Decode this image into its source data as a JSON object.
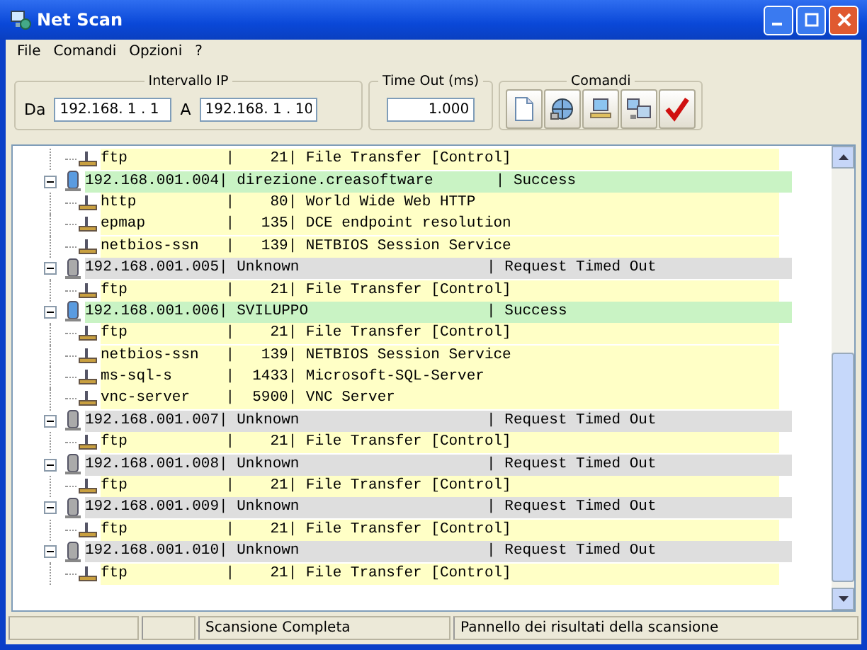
{
  "window": {
    "title": "Net Scan"
  },
  "menu": [
    {
      "label": "File"
    },
    {
      "label": "Comandi"
    },
    {
      "label": "Opzioni"
    },
    {
      "label": "?"
    }
  ],
  "ip_range": {
    "title": "Intervallo IP",
    "from_label": "Da",
    "from": "192.168. 1 . 1",
    "to_label": "A",
    "to": "192.168. 1 . 10"
  },
  "timeout": {
    "title": "Time Out (ms)",
    "value": "1.000"
  },
  "commands": {
    "title": "Comandi",
    "buttons": [
      {
        "kind": "new"
      },
      {
        "kind": "network"
      },
      {
        "kind": "computer"
      },
      {
        "kind": "computers"
      },
      {
        "kind": "check"
      }
    ]
  },
  "tree": [
    {
      "kind": "service",
      "text": "ftp           |    21| File Transfer [Control]"
    },
    {
      "kind": "host",
      "reachable": true,
      "expanded": true,
      "text": "192.168.001.004| direzione.creasoftware       | Success",
      "children": [
        {
          "kind": "service",
          "text": "http          |    80| World Wide Web HTTP"
        },
        {
          "kind": "service",
          "text": "epmap         |   135| DCE endpoint resolution"
        },
        {
          "kind": "service",
          "text": "netbios-ssn   |   139| NETBIOS Session Service"
        }
      ]
    },
    {
      "kind": "host",
      "reachable": false,
      "expanded": true,
      "text": "192.168.001.005| Unknown                     | Request Timed Out",
      "children": [
        {
          "kind": "service",
          "text": "ftp           |    21| File Transfer [Control]"
        }
      ]
    },
    {
      "kind": "host",
      "reachable": true,
      "expanded": true,
      "text": "192.168.001.006| SVILUPPO                    | Success",
      "children": [
        {
          "kind": "service",
          "text": "ftp           |    21| File Transfer [Control]"
        },
        {
          "kind": "service",
          "text": "netbios-ssn   |   139| NETBIOS Session Service"
        },
        {
          "kind": "service",
          "text": "ms-sql-s      |  1433| Microsoft-SQL-Server"
        },
        {
          "kind": "service",
          "text": "vnc-server    |  5900| VNC Server"
        }
      ]
    },
    {
      "kind": "host",
      "reachable": false,
      "expanded": true,
      "text": "192.168.001.007| Unknown                     | Request Timed Out",
      "children": [
        {
          "kind": "service",
          "text": "ftp           |    21| File Transfer [Control]"
        }
      ]
    },
    {
      "kind": "host",
      "reachable": false,
      "expanded": true,
      "text": "192.168.001.008| Unknown                     | Request Timed Out",
      "children": [
        {
          "kind": "service",
          "text": "ftp           |    21| File Transfer [Control]"
        }
      ]
    },
    {
      "kind": "host",
      "reachable": false,
      "expanded": true,
      "text": "192.168.001.009| Unknown                     | Request Timed Out",
      "children": [
        {
          "kind": "service",
          "text": "ftp           |    21| File Transfer [Control]"
        }
      ]
    },
    {
      "kind": "host",
      "reachable": false,
      "expanded": true,
      "text": "192.168.001.010| Unknown                     | Request Timed Out",
      "children": [
        {
          "kind": "service",
          "text": "ftp           |    21| File Transfer [Control]"
        }
      ]
    }
  ],
  "status_bar": [
    "Scansione Completa",
    "Pannello dei risultati della scansione"
  ]
}
